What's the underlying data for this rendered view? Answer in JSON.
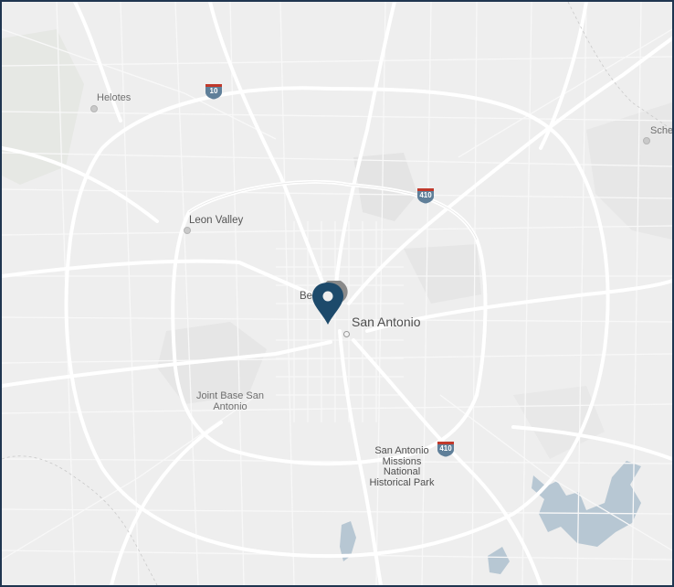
{
  "map": {
    "labels": {
      "helotes": "Helotes",
      "leon_valley": "Leon Valley",
      "bexar": "Bex",
      "san_antonio": "San Antonio",
      "jbsa_line1": "Joint Base San",
      "jbsa_line2": "Antonio",
      "missions_line1": "San Antonio",
      "missions_line2": "Missions",
      "missions_line3": "National",
      "missions_line4": "Historical Park",
      "schertz_partial": "Sche"
    },
    "shields": {
      "i10": "10",
      "i410_north": "410",
      "i410_south": "410"
    },
    "markers": [
      {
        "name": "primary-location",
        "color": "#1d4a6b"
      },
      {
        "name": "secondary-location",
        "color": "#8a8a8a"
      }
    ],
    "colors": {
      "background": "#eeeeee",
      "road": "#ffffff",
      "water": "#b7c7d3",
      "frame": "#1f3550",
      "interstate_shield": "#5f7f99"
    }
  }
}
